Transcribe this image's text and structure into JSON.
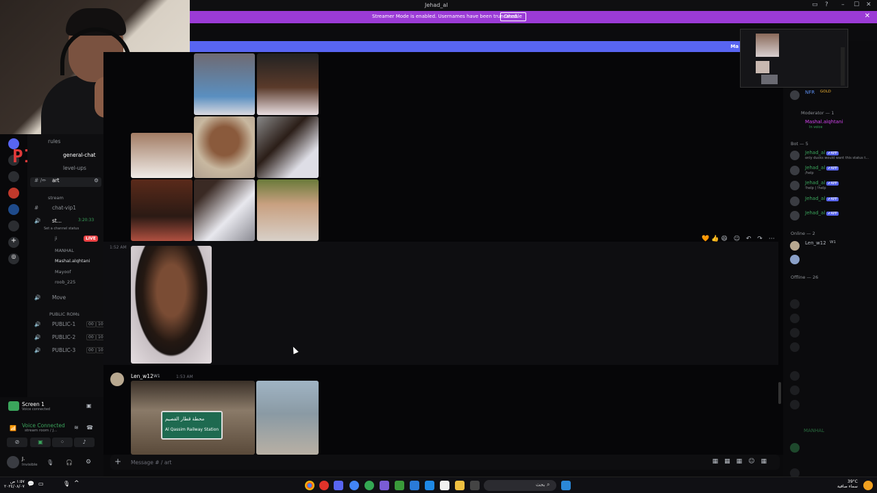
{
  "window": {
    "title": "Jehad_al",
    "min": "–",
    "max": "☐",
    "close": "✕",
    "inbox_icon": "inbox-icon",
    "help": "?"
  },
  "banner": {
    "text": "Streamer Mode is enabled. Usernames have been truncated.",
    "button": "Disable",
    "close": "✕"
  },
  "blue_strip": {
    "text": "Ma"
  },
  "webcam_overlay": {
    "logo_text": "PIXL"
  },
  "channels": {
    "items": [
      {
        "prefix": "📝",
        "label": "rules"
      },
      {
        "prefix": "#",
        "label": "general-chat"
      },
      {
        "prefix": "#",
        "label": "level-ups"
      },
      {
        "prefix": "#",
        "label": "art"
      },
      {
        "prefix": "#",
        "label": "chat-vip1"
      }
    ],
    "stream_category": "stream",
    "voice_channel": {
      "label": "st...",
      "timer": "3:20:33",
      "status": "Set a channel status"
    },
    "voice_users": [
      "ji",
      "MANHAL",
      "Mashal.alqhtani",
      "Mayoof",
      "roob_225"
    ],
    "live_badge": "LIVE",
    "move_channel": "Move",
    "public_category": "PUBLIC ROMs",
    "public_rooms": [
      {
        "label": "PUBLIC-1",
        "count_a": "00",
        "count_b": "10"
      },
      {
        "label": "PUBLIC-2",
        "count_a": "00",
        "count_b": "10"
      },
      {
        "label": "PUBLIC-3",
        "count_a": "00",
        "count_b": "10"
      }
    ]
  },
  "user_panel": {
    "screen_title": "Screen 1",
    "screen_sub": "Voice connected",
    "voice_status": "Voice Connected",
    "voice_sub": "stream room / J...",
    "username": "J.",
    "user_status": "Invisible"
  },
  "chat": {
    "time_1": "1:52 AM",
    "msg2": {
      "author": "Len_w12",
      "badge": "W1",
      "time": "1:53 AM"
    },
    "station_sign_ar": "محطة قطار القصيم",
    "station_sign_en": "Al Qassim Railway Station",
    "reactbar": "🧡👍😄 ☺ ↶ ↷ ⋯",
    "composer_placeholder": "Message #  /  art"
  },
  "members": {
    "top_user": {
      "name": "NFR",
      "badge": "GOLD"
    },
    "moderator_header": "Moderator — 1",
    "moderator": {
      "name": "Mashal.alqhtani",
      "sub": "In voice"
    },
    "bot_header": "Bot — 5",
    "bots": [
      {
        "name": "Jehad_al",
        "sub": "only ducks would want this status t..."
      },
      {
        "name": "Jehad_al",
        "sub": "/help"
      },
      {
        "name": "Jehad_al",
        "sub": "!help | !help"
      },
      {
        "name": "Jehad_al",
        "sub": ""
      },
      {
        "name": "Jehad_al",
        "sub": ""
      }
    ],
    "app_badge": "✔APP",
    "online_header": "Online — 2",
    "online": [
      {
        "name": "Len_w12",
        "badge": "W1"
      }
    ],
    "offline_header": "Offline — 26",
    "offline_visible": [
      "MANHAL"
    ]
  },
  "taskbar": {
    "weather_temp": "39°C",
    "weather_desc": "سماء صافية",
    "search_label": "بحث",
    "clock_time": "١:٥٧ ص",
    "clock_date": "٢٠٢٤/٠٨/٠٧"
  },
  "colors": {
    "accent": "#5865f2",
    "streamer": "#9b3bd6",
    "green": "#3ba55c",
    "red": "#ed4245"
  }
}
